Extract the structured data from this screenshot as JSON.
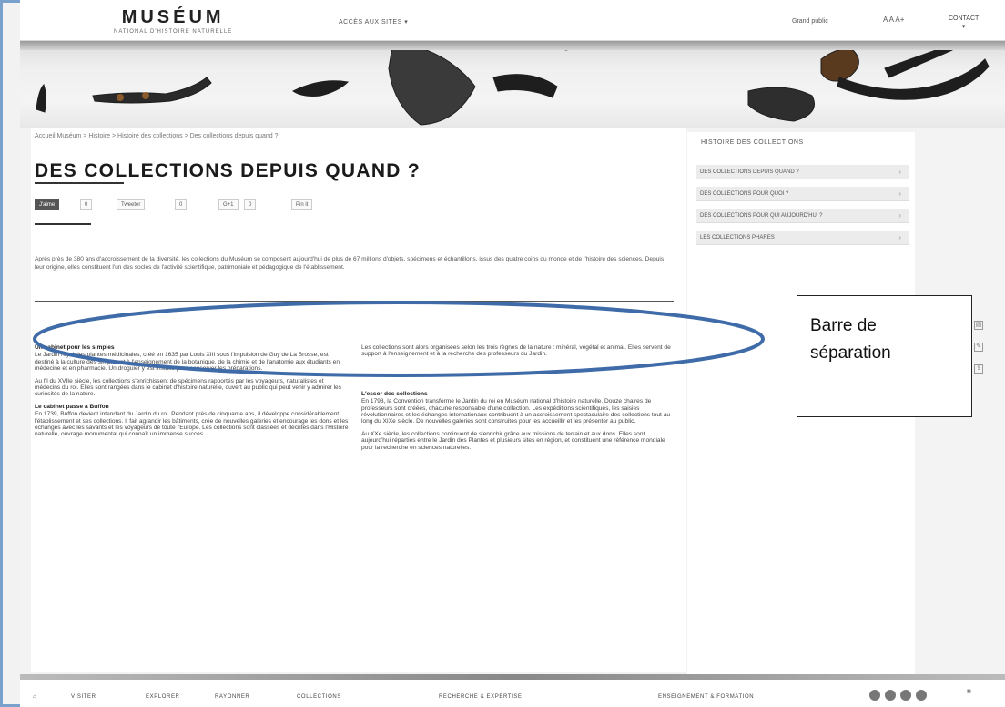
{
  "header": {
    "logo": "MUSÉUM",
    "logo_sub": "NATIONAL D'HISTOIRE NATURELLE",
    "access": "ACCÈS AUX SITES",
    "grand_public": "Grand public",
    "font_size": "A A A+",
    "contact": "CONTACT"
  },
  "breadcrumb": "Accueil Muséum > Histoire > Histoire des collections > Des collections depuis quand ?",
  "title": "DES COLLECTIONS DEPUIS QUAND ?",
  "share": {
    "like": "J'aime",
    "like_count": "0",
    "tweet": "Tweeter",
    "tweet_count": "0",
    "gplus": "G+1",
    "gplus_count": "0",
    "pin": "Pin it"
  },
  "intro": "Après près de 380 ans d'accroissement de la diversité, les collections du Muséum se composent aujourd'hui de plus de 67 millions d'objets, spécimens et échantillons, issus des quatre coins du monde et de l'histoire des sciences. Depuis leur origine, elles constituent l'un des socles de l'activité scientifique, patrimoniale et pédagogique de l'établissement.",
  "col1": {
    "h1": "Un cabinet pour les simples",
    "p1": "Le Jardin royal des plantes médicinales, créé en 1635 par Louis XIII sous l'impulsion de Guy de La Brosse, est destiné à la culture des simples et à l'enseignement de la botanique, de la chimie et de l'anatomie aux étudiants en médecine et en pharmacie. Un droguier y est installé pour conserver les préparations.",
    "p2": "Au fil du XVIIe siècle, les collections s'enrichissent de spécimens rapportés par les voyageurs, naturalistes et médecins du roi. Elles sont rangées dans le cabinet d'histoire naturelle, ouvert au public qui peut venir y admirer les curiosités de la nature.",
    "h2": "Le cabinet passe à Buffon",
    "p3": "En 1739, Buffon devient intendant du Jardin du roi. Pendant près de cinquante ans, il développe considérablement l'établissement et ses collections. Il fait agrandir les bâtiments, crée de nouvelles galeries et encourage les dons et les échanges avec les savants et les voyageurs de toute l'Europe. Les collections sont classées et décrites dans l'Histoire naturelle, ouvrage monumental qui connaît un immense succès."
  },
  "col2": {
    "p1": "Les collections sont alors organisées selon les trois règnes de la nature : minéral, végétal et animal. Elles servent de support à l'enseignement et à la recherche des professeurs du Jardin.",
    "h1": "L'essor des collections",
    "p2": "En 1793, la Convention transforme le Jardin du roi en Muséum national d'histoire naturelle. Douze chaires de professeurs sont créées, chacune responsable d'une collection. Les expéditions scientifiques, les saisies révolutionnaires et les échanges internationaux contribuent à un accroissement spectaculaire des collections tout au long du XIXe siècle. De nouvelles galeries sont construites pour les accueillir et les présenter au public.",
    "p3": "Au XXe siècle, les collections continuent de s'enrichir grâce aux missions de terrain et aux dons. Elles sont aujourd'hui réparties entre le Jardin des Plantes et plusieurs sites en région, et constituent une référence mondiale pour la recherche en sciences naturelles."
  },
  "sidebar": {
    "title": "HISTOIRE DES COLLECTIONS",
    "items": [
      "DES COLLECTIONS DEPUIS QUAND ?",
      "DES COLLECTIONS POUR QUOI ?",
      "DES COLLECTIONS POUR QUI AUJOURD'HUI ?",
      "LES COLLECTIONS PHARES"
    ]
  },
  "annotation": {
    "line1": "Barre de",
    "line2": "séparation"
  },
  "footer": {
    "nav": [
      "VISITER",
      "EXPLORER",
      "RAYONNER",
      "COLLECTIONS",
      "RECHERCHE & EXPERTISE",
      "ENSEIGNEMENT & FORMATION"
    ]
  },
  "colors": {
    "annotation_stroke": "#3f6ca8",
    "frame_border": "#7aa0cc"
  }
}
